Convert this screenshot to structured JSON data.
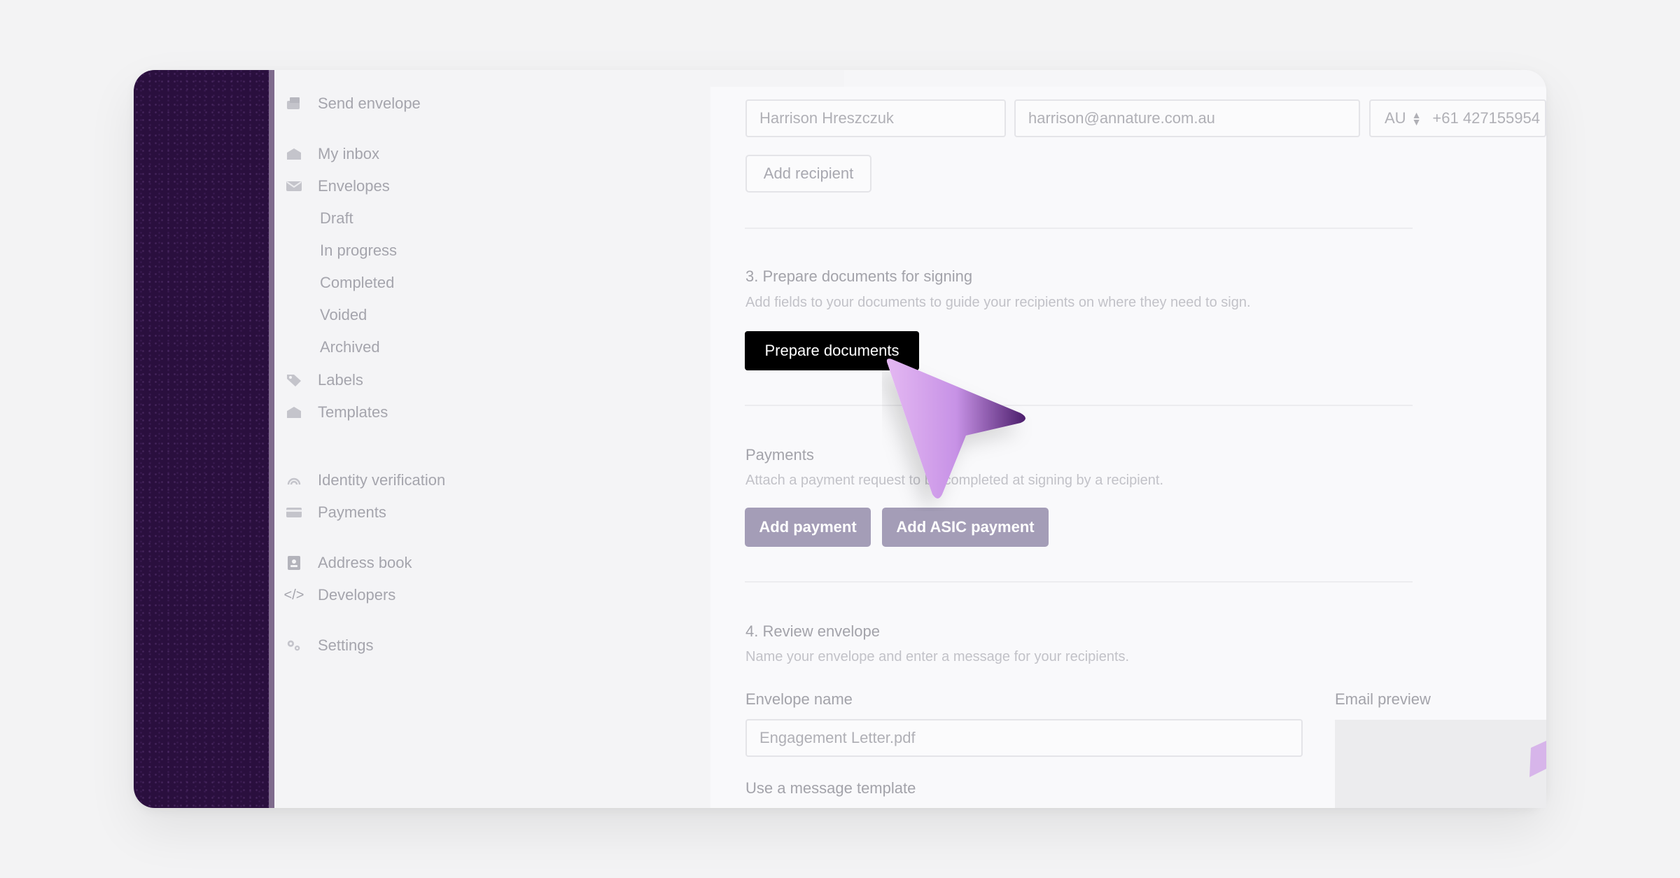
{
  "sidebar": {
    "send_envelope": "Send envelope",
    "my_inbox": "My inbox",
    "envelopes": "Envelopes",
    "draft": "Draft",
    "in_progress": "In progress",
    "completed": "Completed",
    "voided": "Voided",
    "archived": "Archived",
    "labels": "Labels",
    "templates": "Templates",
    "identity_verification": "Identity verification",
    "payments": "Payments",
    "address_book": "Address book",
    "developers": "Developers",
    "settings": "Settings"
  },
  "recipient": {
    "name": "Harrison Hreszczuk",
    "email": "harrison@annature.com.au",
    "country": "AU",
    "phone": "+61 427155954",
    "add_recipient": "Add recipient"
  },
  "prepare": {
    "heading": "3. Prepare documents for signing",
    "description": "Add fields to your documents to guide your recipients on where they need to sign.",
    "button": "Prepare documents"
  },
  "payments": {
    "heading": "Payments",
    "description": "Attach a payment request to be completed at signing by a recipient.",
    "add_payment": "Add payment",
    "add_asic_payment": "Add ASIC payment"
  },
  "review": {
    "heading": "4. Review envelope",
    "description": "Name your envelope and enter a message for your recipients.",
    "envelope_name_label": "Envelope name",
    "envelope_name_value": "Engagement Letter.pdf",
    "email_preview_label": "Email preview",
    "message_template_label": "Use a message template"
  },
  "colors": {
    "rail": "#2a0f3e",
    "primary_button": "#000000",
    "payment_button": "#a49db7",
    "cursor": "#c792e6"
  }
}
